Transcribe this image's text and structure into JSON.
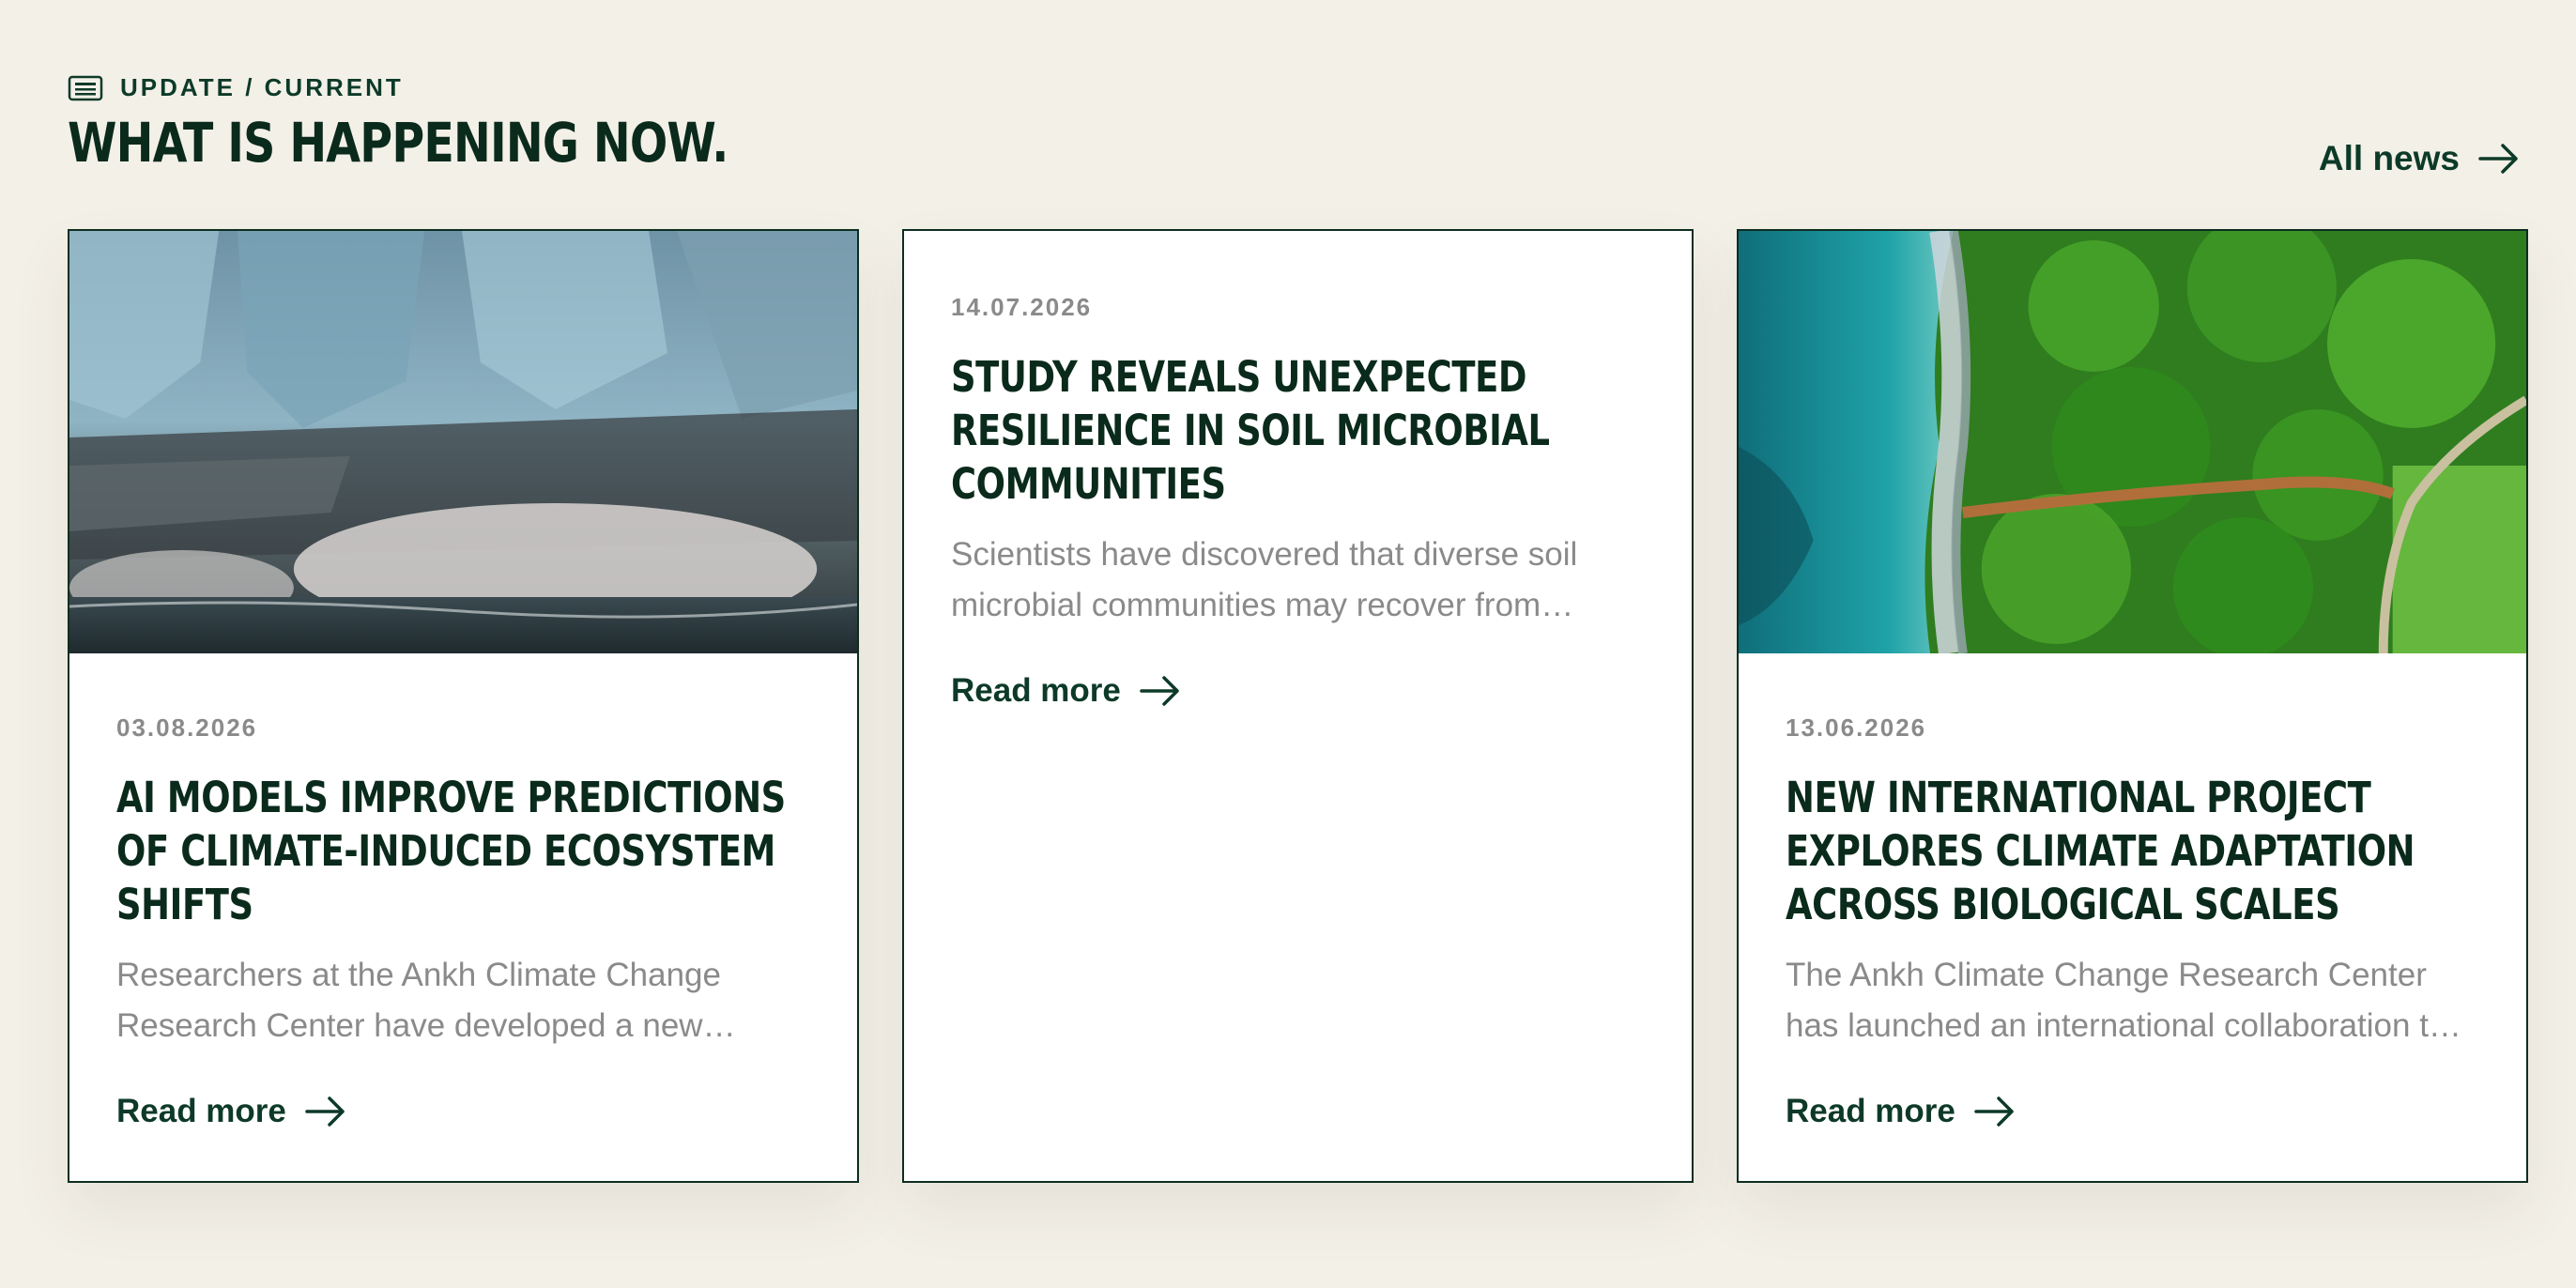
{
  "section": {
    "eyebrow": "UPDATE / CURRENT",
    "title": "WHAT IS HAPPENING NOW.",
    "all_news_label": "All news"
  },
  "cards": [
    {
      "date": "03.08.2026",
      "title": "AI MODELS IMPROVE PREDICTIONS OF CLIMATE-INDUCED ECOSYSTEM SHIFTS",
      "excerpt": "Researchers at the Ankh Climate Change Research Center have developed a new…",
      "read_more": "Read more",
      "image": "glacier-calving-photo"
    },
    {
      "date": "14.07.2026",
      "title": "STUDY REVEALS UNEXPECTED RESILIENCE IN SOIL MICROBIAL COMMUNITIES",
      "excerpt": "Scientists have discovered that diverse soil microbial communities may recover from…",
      "read_more": "Read more",
      "image": null
    },
    {
      "date": "13.06.2026",
      "title": "NEW INTERNATIONAL PROJECT EXPLORES CLIMATE ADAPTATION ACROSS BIOLOGICAL SCALES",
      "excerpt": "The Ankh Climate Change Research Center has launched an international collaboration t…",
      "read_more": "Read more",
      "image": "coastline-forest-aerial-photo"
    }
  ],
  "icons": {
    "eyebrow": "newspaper-icon",
    "arrow": "arrow-right-icon"
  },
  "colors": {
    "background": "#f3f0e8",
    "brand_dark_green": "#0d2e20",
    "muted_text": "#8a8a8a",
    "card_bg": "#ffffff"
  }
}
